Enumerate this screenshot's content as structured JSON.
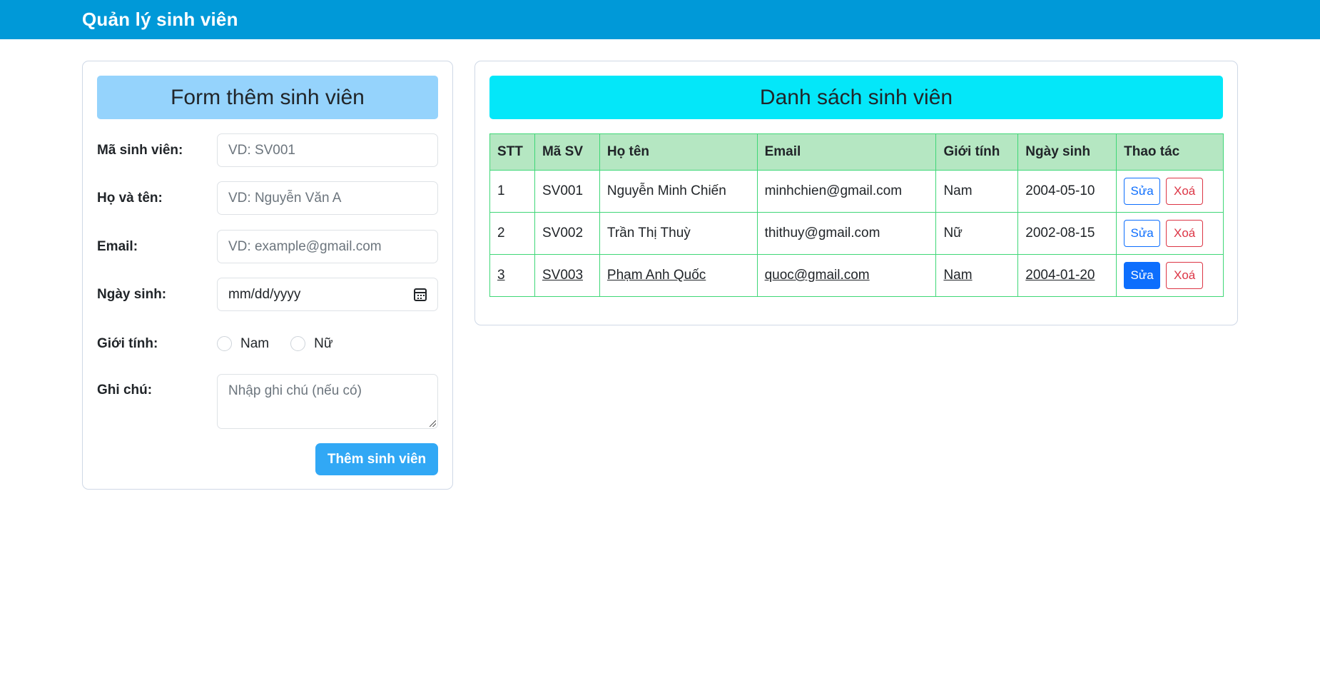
{
  "navbar": {
    "brand": "Quản lý sinh viên"
  },
  "form": {
    "title": "Form thêm sinh viên",
    "fields": {
      "student_id": {
        "label": "Mã sinh viên:",
        "placeholder": "VD: SV001"
      },
      "full_name": {
        "label": "Họ và tên:",
        "placeholder": "VD: Nguyễn Văn A"
      },
      "email": {
        "label": "Email:",
        "placeholder": "VD: example@gmail.com"
      },
      "birthdate": {
        "label": "Ngày sinh:",
        "placeholder": "mm/dd/yyyy",
        "icon": "calendar-icon"
      },
      "gender": {
        "label": "Giới tính:",
        "options": [
          "Nam",
          "Nữ"
        ]
      },
      "note": {
        "label": "Ghi chú:",
        "placeholder": "Nhập ghi chú (nếu có)"
      }
    },
    "submit_label": "Thêm sinh viên"
  },
  "list": {
    "title": "Danh sách sinh viên",
    "columns": [
      "STT",
      "Mã SV",
      "Họ tên",
      "Email",
      "Giới tính",
      "Ngày sinh",
      "Thao tác"
    ],
    "rows": [
      {
        "stt": "1",
        "id": "SV001",
        "name": "Nguyễn Minh Chiến",
        "email": "minhchien@gmail.com",
        "gender": "Nam",
        "birthdate": "2004-05-10",
        "edit": "Sửa",
        "delete": "Xoá"
      },
      {
        "stt": "2",
        "id": "SV002",
        "name": "Trần Thị Thuỳ",
        "email": "thithuy@gmail.com",
        "gender": "Nữ",
        "birthdate": "2002-08-15",
        "edit": "Sửa",
        "delete": "Xoá"
      },
      {
        "stt": "3",
        "id": "SV003",
        "name": "Phạm Anh Quốc",
        "email": "quoc@gmail.com",
        "gender": "Nam",
        "birthdate": "2004-01-20",
        "edit": "Sửa",
        "delete": "Xoá"
      }
    ]
  },
  "colors": {
    "navbar": "#0099d8",
    "form_header": "#95d3fc",
    "list_header": "#04e7f9",
    "table_head": "#b5e7c2",
    "table_border": "#3fd777",
    "submit": "#31a8f5"
  }
}
